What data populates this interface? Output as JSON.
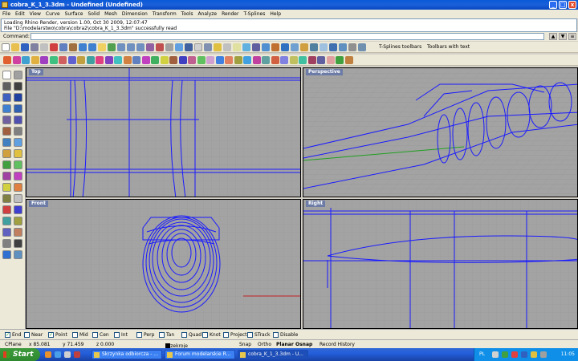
{
  "window": {
    "title": "cobra_K_1_3.3dm - Undefined (Undefined)",
    "minimize": "_",
    "maximize": "□",
    "close": "x"
  },
  "menu": [
    "File",
    "Edit",
    "View",
    "Curve",
    "Surface",
    "Solid",
    "Mesh",
    "Dimension",
    "Transform",
    "Tools",
    "Analyze",
    "Render",
    "T-Splines",
    "Help"
  ],
  "command_history": [
    "Loading Rhino Render, version 1.00, Oct 30 2009, 12:07:47",
    "File \"D:\\modelarstwo\\cobra\\cobra2\\cobra_K_1_3.3dm\" successfully read"
  ],
  "command": {
    "label": "Command:",
    "value": ""
  },
  "toolbar_buttons": {
    "tsplines": "T-Splines toolbars",
    "withtext": "Toolbars with text"
  },
  "viewports": {
    "top": "Top",
    "perspective": "Perspective",
    "front": "Front",
    "right": "Right"
  },
  "osnaps": [
    {
      "label": "End",
      "checked": true
    },
    {
      "label": "Near",
      "checked": false
    },
    {
      "label": "Point",
      "checked": true
    },
    {
      "label": "Mid",
      "checked": false
    },
    {
      "label": "Cen",
      "checked": false
    },
    {
      "label": "Int",
      "checked": false
    },
    {
      "label": "Perp",
      "checked": false
    },
    {
      "label": "Tan",
      "checked": false
    },
    {
      "label": "Quad",
      "checked": false
    },
    {
      "label": "Knot",
      "checked": false
    },
    {
      "label": "Project",
      "checked": false
    },
    {
      "label": "STrack",
      "checked": false
    },
    {
      "label": "Disable",
      "checked": false
    }
  ],
  "status": {
    "cplane": "CPlane",
    "x": "x 85.081",
    "y": "y 71.459",
    "z": "z 0.000",
    "layer": "przekroje",
    "snap": "Snap",
    "ortho": "Ortho",
    "planar": "Planar",
    "osnap": "Osnap",
    "record": "Record History"
  },
  "taskbar": {
    "start": "Start",
    "items": [
      "Skrzynka odbiorcza - ...",
      "Forum modelarskie R...",
      "cobra_K_1_3.3dm - U..."
    ],
    "lang": "PL",
    "clock": "11:05"
  },
  "colors": {
    "accent": "#0a5ad8",
    "wire": "#1a1aff",
    "viewport_bg": "#a3a3a3",
    "active_title": "#6c7ca6"
  }
}
